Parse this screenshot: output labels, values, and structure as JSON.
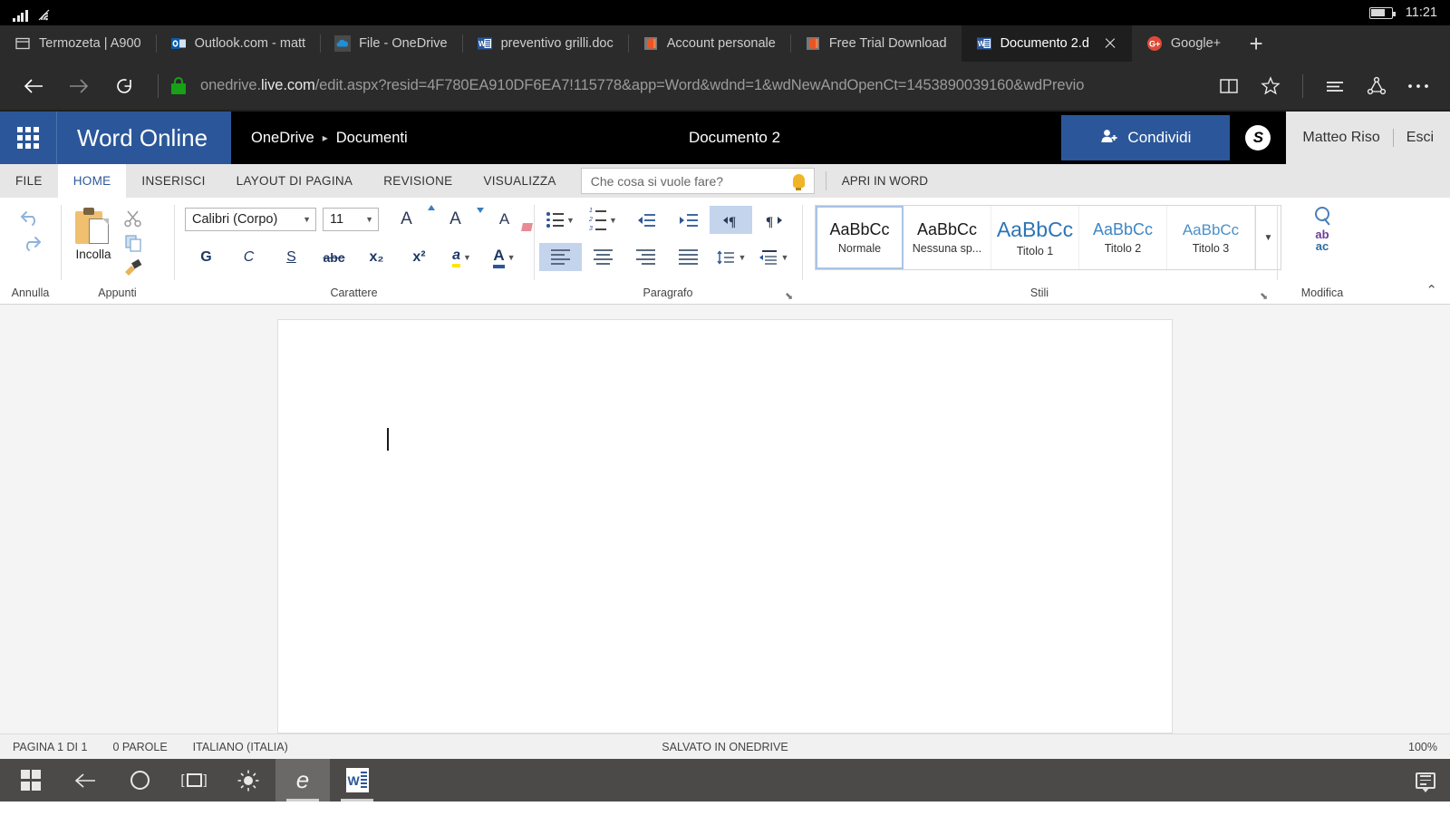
{
  "system": {
    "clock": "11:21",
    "signal_icon": "signal-bars-icon",
    "wifi_icon": "wifi-icon",
    "battery_icon": "battery-icon"
  },
  "browser": {
    "tabs": [
      {
        "label": "Termozeta | A900",
        "favicon": "window-icon",
        "active": false
      },
      {
        "label": "Outlook.com - matt",
        "favicon": "outlook-icon",
        "active": false
      },
      {
        "label": "File - OneDrive",
        "favicon": "onedrive-icon",
        "active": false
      },
      {
        "label": "preventivo grilli.doc",
        "favicon": "word-icon",
        "active": false
      },
      {
        "label": "Account personale",
        "favicon": "office-icon",
        "active": false
      },
      {
        "label": "Free Trial Download",
        "favicon": "office-icon",
        "active": false
      },
      {
        "label": "Documento 2.d",
        "favicon": "word-icon",
        "active": true
      },
      {
        "label": "Google+",
        "favicon": "googleplus-icon",
        "active": false
      }
    ],
    "new_tab_label": "+",
    "nav": {
      "back": "back-arrow-icon",
      "forward": "forward-arrow-icon",
      "refresh": "refresh-icon"
    },
    "url_prefix": "onedrive.",
    "url_domain": "live.com",
    "url_suffix": "/edit.aspx?resid=4F780EA910DF6EA7!115778&app=Word&wdnd=1&wdNewAndOpenCt=1453890039160&wdPrevio",
    "icons": {
      "reading_view": "book-icon",
      "favorite": "star-icon",
      "hub": "hub-lines-icon",
      "share": "share-icon",
      "more": "more-dots-icon"
    }
  },
  "app_header": {
    "waffle": "app-launcher-icon",
    "brand": "Word Online",
    "breadcrumb_root": "OneDrive",
    "breadcrumb_sep": "▸",
    "breadcrumb_leaf": "Documenti",
    "document_title": "Documento 2",
    "share_button": "Condividi",
    "share_icon": "person-add-icon",
    "skype_icon": "skype-icon",
    "skype_letter": "S",
    "user_name": "Matteo Riso",
    "sign_out": "Esci",
    "accent_color": "#2b579a"
  },
  "ribbon_tabs": {
    "items": [
      {
        "label": "FILE",
        "active": false
      },
      {
        "label": "HOME",
        "active": true
      },
      {
        "label": "INSERISCI",
        "active": false
      },
      {
        "label": "LAYOUT DI PAGINA",
        "active": false
      },
      {
        "label": "REVISIONE",
        "active": false
      },
      {
        "label": "VISUALIZZA",
        "active": false
      }
    ],
    "tell_me_placeholder": "Che cosa si vuole fare?",
    "bulb_icon": "lightbulb-icon",
    "open_in_word": "APRI IN WORD"
  },
  "ribbon": {
    "undo_group": {
      "label": "Annulla",
      "undo_icon": "undo-arrow-icon",
      "redo_icon": "redo-arrow-icon"
    },
    "clipboard_group": {
      "label": "Appunti",
      "paste_label": "Incolla",
      "paste_icon": "clipboard-icon",
      "cut_icon": "scissors-icon",
      "copy_icon": "copy-icon",
      "format_painter_icon": "format-painter-icon"
    },
    "font_group": {
      "label": "Carattere",
      "font_name": "Calibri (Corpo)",
      "font_size": "11",
      "grow_icon": "grow-font-icon",
      "shrink_icon": "shrink-font-icon",
      "clear_format_icon": "clear-formatting-icon",
      "bold": "G",
      "italic": "C",
      "underline": "S",
      "strikethrough": "abc",
      "subscript": "x₂",
      "superscript": "x²",
      "highlight": "a",
      "font_color": "A",
      "highlight_color": "#ffe500",
      "font_color_value": "#2b579a"
    },
    "paragraph_group": {
      "label": "Paragrafo",
      "bullets_icon": "bulleted-list-icon",
      "numbering_icon": "numbered-list-icon",
      "decrease_indent_icon": "decrease-indent-icon",
      "increase_indent_icon": "increase-indent-icon",
      "ltr_icon": "left-to-right-icon",
      "rtl_icon": "right-to-left-icon",
      "align_left_icon": "align-left-icon",
      "align_center_icon": "align-center-icon",
      "align_right_icon": "align-right-icon",
      "justify_icon": "justify-icon",
      "line_spacing_icon": "line-spacing-icon",
      "shading_icon": "paragraph-shading-icon"
    },
    "styles_group": {
      "label": "Stili",
      "items": [
        {
          "sample": "AaBbCc",
          "name": "Normale",
          "selected": true
        },
        {
          "sample": "AaBbCc",
          "name": "Nessuna sp...",
          "selected": false
        },
        {
          "sample": "AaBbCc",
          "name": "Titolo 1",
          "selected": false
        },
        {
          "sample": "AaBbCc",
          "name": "Titolo 2",
          "selected": false
        },
        {
          "sample": "AaBbCc",
          "name": "Titolo 3",
          "selected": false
        }
      ],
      "more_icon": "chevron-down-icon"
    },
    "editing_group": {
      "label": "Modifica",
      "find_icon": "search-icon",
      "replace_icon": "replace-icon",
      "replace_from": "ab",
      "replace_to": "ac"
    },
    "collapse_icon": "chevron-up-icon"
  },
  "document": {
    "caret": "text-cursor",
    "page_content": ""
  },
  "status_bar": {
    "page": "PAGINA 1 DI 1",
    "words": "0 PAROLE",
    "language": "ITALIANO (ITALIA)",
    "saved": "SALVATO IN ONEDRIVE",
    "zoom": "100%"
  },
  "taskbar": {
    "start_icon": "windows-start-icon",
    "back_icon": "back-arrow-icon",
    "cortana_icon": "cortana-circle-icon",
    "task_view_icon": "task-view-icon",
    "brightness_icon": "brightness-icon",
    "edge_icon": "edge-browser-icon",
    "word_icon": "word-app-icon",
    "action_center_icon": "action-center-icon"
  }
}
